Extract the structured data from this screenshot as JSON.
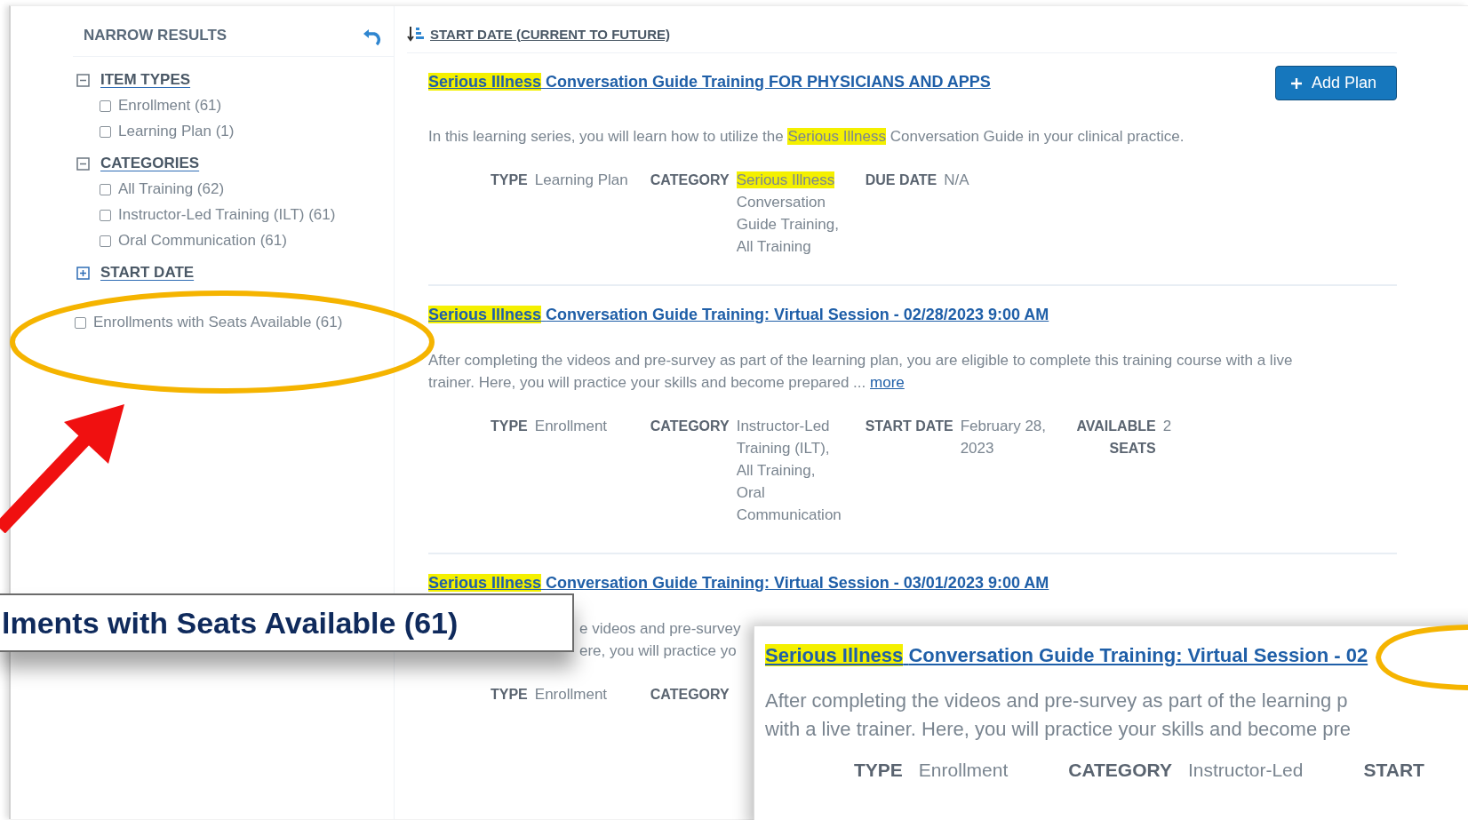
{
  "sidebar": {
    "title": "NARROW RESULTS",
    "sections": [
      {
        "label": "ITEM TYPES",
        "expanded": true,
        "options": [
          {
            "label": "Enrollment (61)",
            "checked": false
          },
          {
            "label": "Learning Plan (1)",
            "checked": false
          }
        ]
      },
      {
        "label": "CATEGORIES",
        "expanded": true,
        "options": [
          {
            "label": "All Training (62)",
            "checked": false
          },
          {
            "label": "Instructor-Led Training (ILT) (61)",
            "checked": false
          },
          {
            "label": "Oral Communication (61)",
            "checked": false
          }
        ]
      },
      {
        "label": "START DATE",
        "expanded": false
      }
    ],
    "seats_filter": {
      "label": "Enrollments with Seats Available (61)",
      "checked": false
    }
  },
  "sort": {
    "label": "START DATE (CURRENT TO FUTURE)"
  },
  "results": [
    {
      "title_highlight": "Serious Illness",
      "title": "Conversation Guide Training FOR PHYSICIANS AND APPS",
      "button": "Add Plan",
      "description": [
        {
          "text": "In this learning series, you will learn how to utilize the ",
          "highlight": false
        },
        {
          "text": "Serious Illness",
          "highlight": true
        },
        {
          "text": " Conversation Guide in your clinical practice.",
          "highlight": false
        }
      ],
      "meta": [
        {
          "label": "TYPE",
          "value": [
            {
              "text": "Learning Plan",
              "highlight": false
            }
          ]
        },
        {
          "label": "CATEGORY",
          "value": [
            {
              "text": "Serious Illness",
              "highlight": true
            },
            {
              "text": " Conversation Guide Training, All Training",
              "highlight": false
            }
          ]
        },
        {
          "label": "DUE DATE",
          "value": [
            {
              "text": "N/A",
              "highlight": false
            }
          ]
        }
      ]
    },
    {
      "title_highlight": "Serious Illness",
      "title": "Conversation Guide Training: Virtual Session - 02/28/2023 9:00 AM",
      "description": [
        {
          "text": "After completing the videos and pre-survey as part of the learning plan, you are eligible to complete this training course with a live trainer. Here, you will practice your skills and become prepared ... ",
          "highlight": false
        }
      ],
      "more": "more",
      "meta": [
        {
          "label": "TYPE",
          "value": [
            {
              "text": "Enrollment",
              "highlight": false
            }
          ]
        },
        {
          "label": "CATEGORY",
          "value": [
            {
              "text": "Instructor-Led Training (ILT), All Training, Oral Communication",
              "highlight": false
            }
          ]
        },
        {
          "label": "START DATE",
          "value": [
            {
              "text": "February 28, 2023",
              "highlight": false
            }
          ]
        },
        {
          "label": "AVAILABLE SEATS",
          "value": [
            {
              "text": "2",
              "highlight": false
            }
          ]
        }
      ]
    },
    {
      "title_highlight": "Serious Illness",
      "title": "Conversation Guide Training: Virtual Session - 03/01/2023 9:00 AM",
      "fragments": [
        "e videos and pre-survey",
        "ere, you will practice yo"
      ],
      "meta": [
        {
          "label": "TYPE",
          "value": [
            {
              "text": "Enrollment",
              "highlight": false
            }
          ]
        },
        {
          "label": "CATEGORY"
        }
      ]
    }
  ],
  "callout": {
    "text": "lments with Seats Available (61)"
  },
  "inset": {
    "title_highlight": "Serious Illness",
    "title": "Conversation Guide Training: Virtual Session - 02",
    "description": [
      "After completing the videos and pre-survey as part of the learning p",
      "with a live trainer. Here, you will practice your skills and become pre"
    ],
    "meta": [
      {
        "label": "TYPE",
        "value": "Enrollment"
      },
      {
        "label": "CATEGORY",
        "value": "Instructor-Led"
      },
      {
        "label": "START"
      }
    ]
  }
}
